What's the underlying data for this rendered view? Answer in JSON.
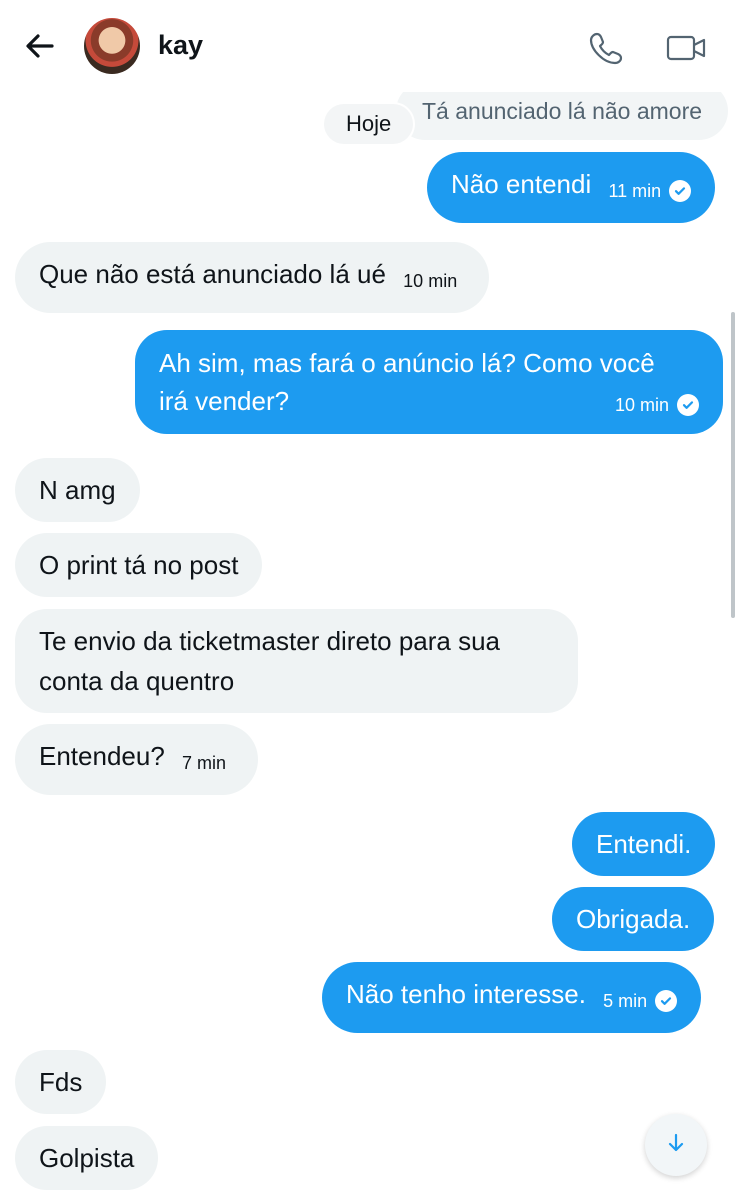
{
  "header": {
    "contact_name": "kay",
    "icons": [
      "back-arrow-icon",
      "phone-icon",
      "video-camera-icon"
    ]
  },
  "preview_text": "Tá anunciado lá não amore",
  "date_label": "Hoje",
  "messages": [
    {
      "direction": "outgoing",
      "text": "Não entendi",
      "time": "11 min",
      "read": true
    },
    {
      "direction": "incoming",
      "text": "Que não está anunciado lá ué",
      "time": "10 min"
    },
    {
      "direction": "outgoing",
      "line1": "Ah sim, mas fará o anúncio lá? Como você",
      "line2": "irá vender?",
      "time": "10 min",
      "read": true
    },
    {
      "direction": "incoming",
      "text": "N amg"
    },
    {
      "direction": "incoming",
      "text": "O print tá no post"
    },
    {
      "direction": "incoming",
      "line1": "Te envio da ticketmaster direto para sua",
      "line2": "conta da quentro"
    },
    {
      "direction": "incoming",
      "text": "Entendeu?",
      "time": "7 min"
    },
    {
      "direction": "outgoing",
      "text": "Entendi."
    },
    {
      "direction": "outgoing",
      "text": "Obrigada."
    },
    {
      "direction": "outgoing",
      "text": "Não tenho interesse.",
      "time": "5 min",
      "read": true
    },
    {
      "direction": "incoming",
      "text": "Fds"
    },
    {
      "direction": "incoming",
      "text": "Golpista"
    }
  ],
  "colors": {
    "outgoing_bubble": "#1d9bf0",
    "incoming_bubble": "#eff3f4",
    "accent": "#1d9bf0"
  }
}
